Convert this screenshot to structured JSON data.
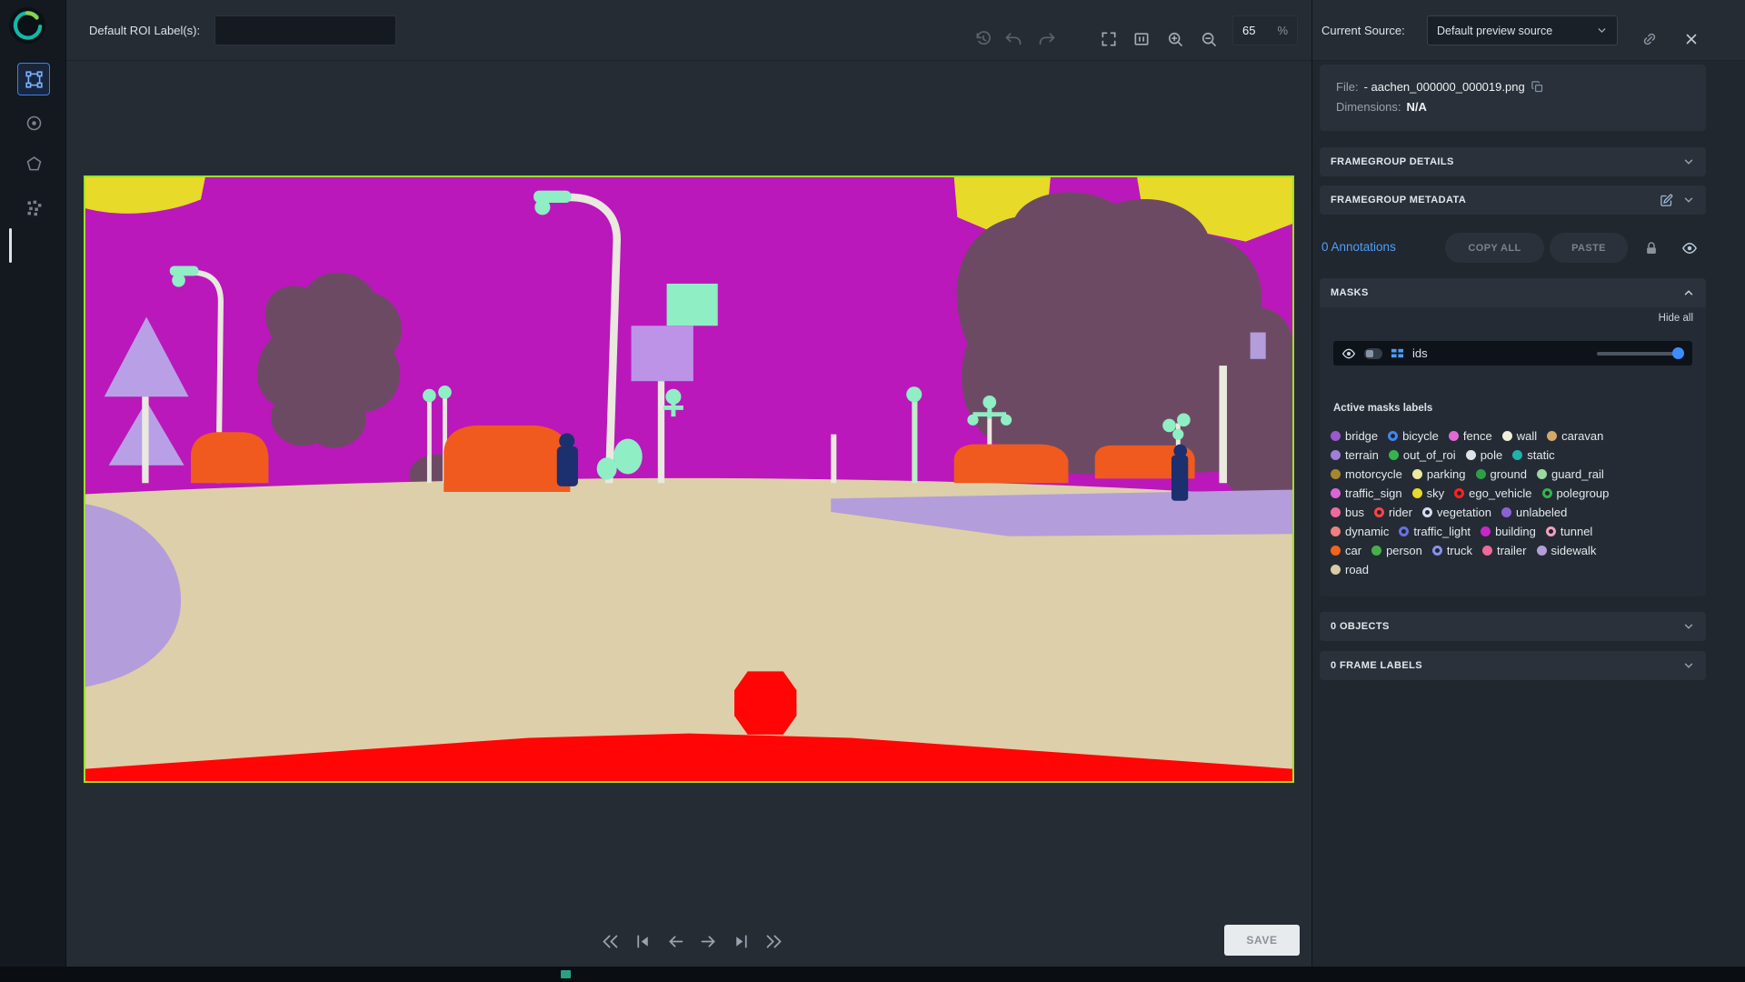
{
  "topbar": {
    "roi_label": "Default ROI Label(s):",
    "roi_input_value": "",
    "zoom_value": "65",
    "zoom_unit": "%"
  },
  "source": {
    "label": "Current Source:",
    "dropdown_value": "Default preview source"
  },
  "file_info": {
    "file_label": "File:",
    "file_name": "- aachen_000000_000019.png",
    "dimensions_label": "Dimensions:",
    "dimensions_value": "N/A"
  },
  "sections": {
    "framegroup_details": "FRAMEGROUP DETAILS",
    "framegroup_metadata": "FRAMEGROUP METADATA",
    "annotations": "0 Annotations",
    "copy_all": "COPY ALL",
    "paste": "PASTE",
    "masks": "MASKS",
    "hide_all": "Hide all",
    "mask_layer_name": "ids",
    "active_masks_title": "Active masks labels",
    "objects": "0 OBJECTS",
    "frame_labels": "0 FRAME LABELS"
  },
  "footer": {
    "save": "SAVE"
  },
  "roi_border_color": "#9de02a",
  "mask_labels_rows": [
    [
      {
        "label": "bridge",
        "color": "#9b59d0",
        "ring": false
      },
      {
        "label": "bicycle",
        "color": "#4285f4",
        "ring": true
      },
      {
        "label": "fence",
        "color": "#e06ad4",
        "ring": false
      },
      {
        "label": "wall",
        "color": "#f0f0dc",
        "ring": false
      },
      {
        "label": "caravan",
        "color": "#d2a96a",
        "ring": false
      }
    ],
    [
      {
        "label": "terrain",
        "color": "#9f7fdb",
        "ring": false
      },
      {
        "label": "out_of_roi",
        "color": "#37b24d",
        "ring": false
      },
      {
        "label": "pole",
        "color": "#dfe3e8",
        "ring": false
      },
      {
        "label": "static",
        "color": "#20b2aa",
        "ring": false
      }
    ],
    [
      {
        "label": "motorcycle",
        "color": "#a8862c",
        "ring": false
      },
      {
        "label": "parking",
        "color": "#efe8a0",
        "ring": false
      },
      {
        "label": "ground",
        "color": "#2f9e44",
        "ring": false
      },
      {
        "label": "guard_rail",
        "color": "#9ad9a0",
        "ring": false
      }
    ],
    [
      {
        "label": "traffic_sign",
        "color": "#d966d9",
        "ring": false
      },
      {
        "label": "sky",
        "color": "#e8d92e",
        "ring": false
      },
      {
        "label": "ego_vehicle",
        "color": "#ff2222",
        "ring": true
      },
      {
        "label": "polegroup",
        "color": "#37b24d",
        "ring": true
      }
    ],
    [
      {
        "label": "bus",
        "color": "#ef6aa0",
        "ring": false
      },
      {
        "label": "rider",
        "color": "#ff4444",
        "ring": true
      },
      {
        "label": "vegetation",
        "color": "#d9d9ef",
        "ring": true
      },
      {
        "label": "unlabeled",
        "color": "#8a63d2",
        "ring": false
      }
    ],
    [
      {
        "label": "dynamic",
        "color": "#ef8080",
        "ring": false
      },
      {
        "label": "traffic_light",
        "color": "#6673e0",
        "ring": true
      },
      {
        "label": "building",
        "color": "#c928c9",
        "ring": false
      },
      {
        "label": "tunnel",
        "color": "#f2a0c0",
        "ring": true
      }
    ],
    [
      {
        "label": "car",
        "color": "#f2641e",
        "ring": false
      },
      {
        "label": "person",
        "color": "#47b04b",
        "ring": false
      },
      {
        "label": "truck",
        "color": "#8891e8",
        "ring": true
      },
      {
        "label": "trailer",
        "color": "#ef6a9a",
        "ring": false
      },
      {
        "label": "sidewalk",
        "color": "#b49ddb",
        "ring": false
      }
    ],
    [
      {
        "label": "road",
        "color": "#d9cba6",
        "ring": false
      }
    ]
  ]
}
